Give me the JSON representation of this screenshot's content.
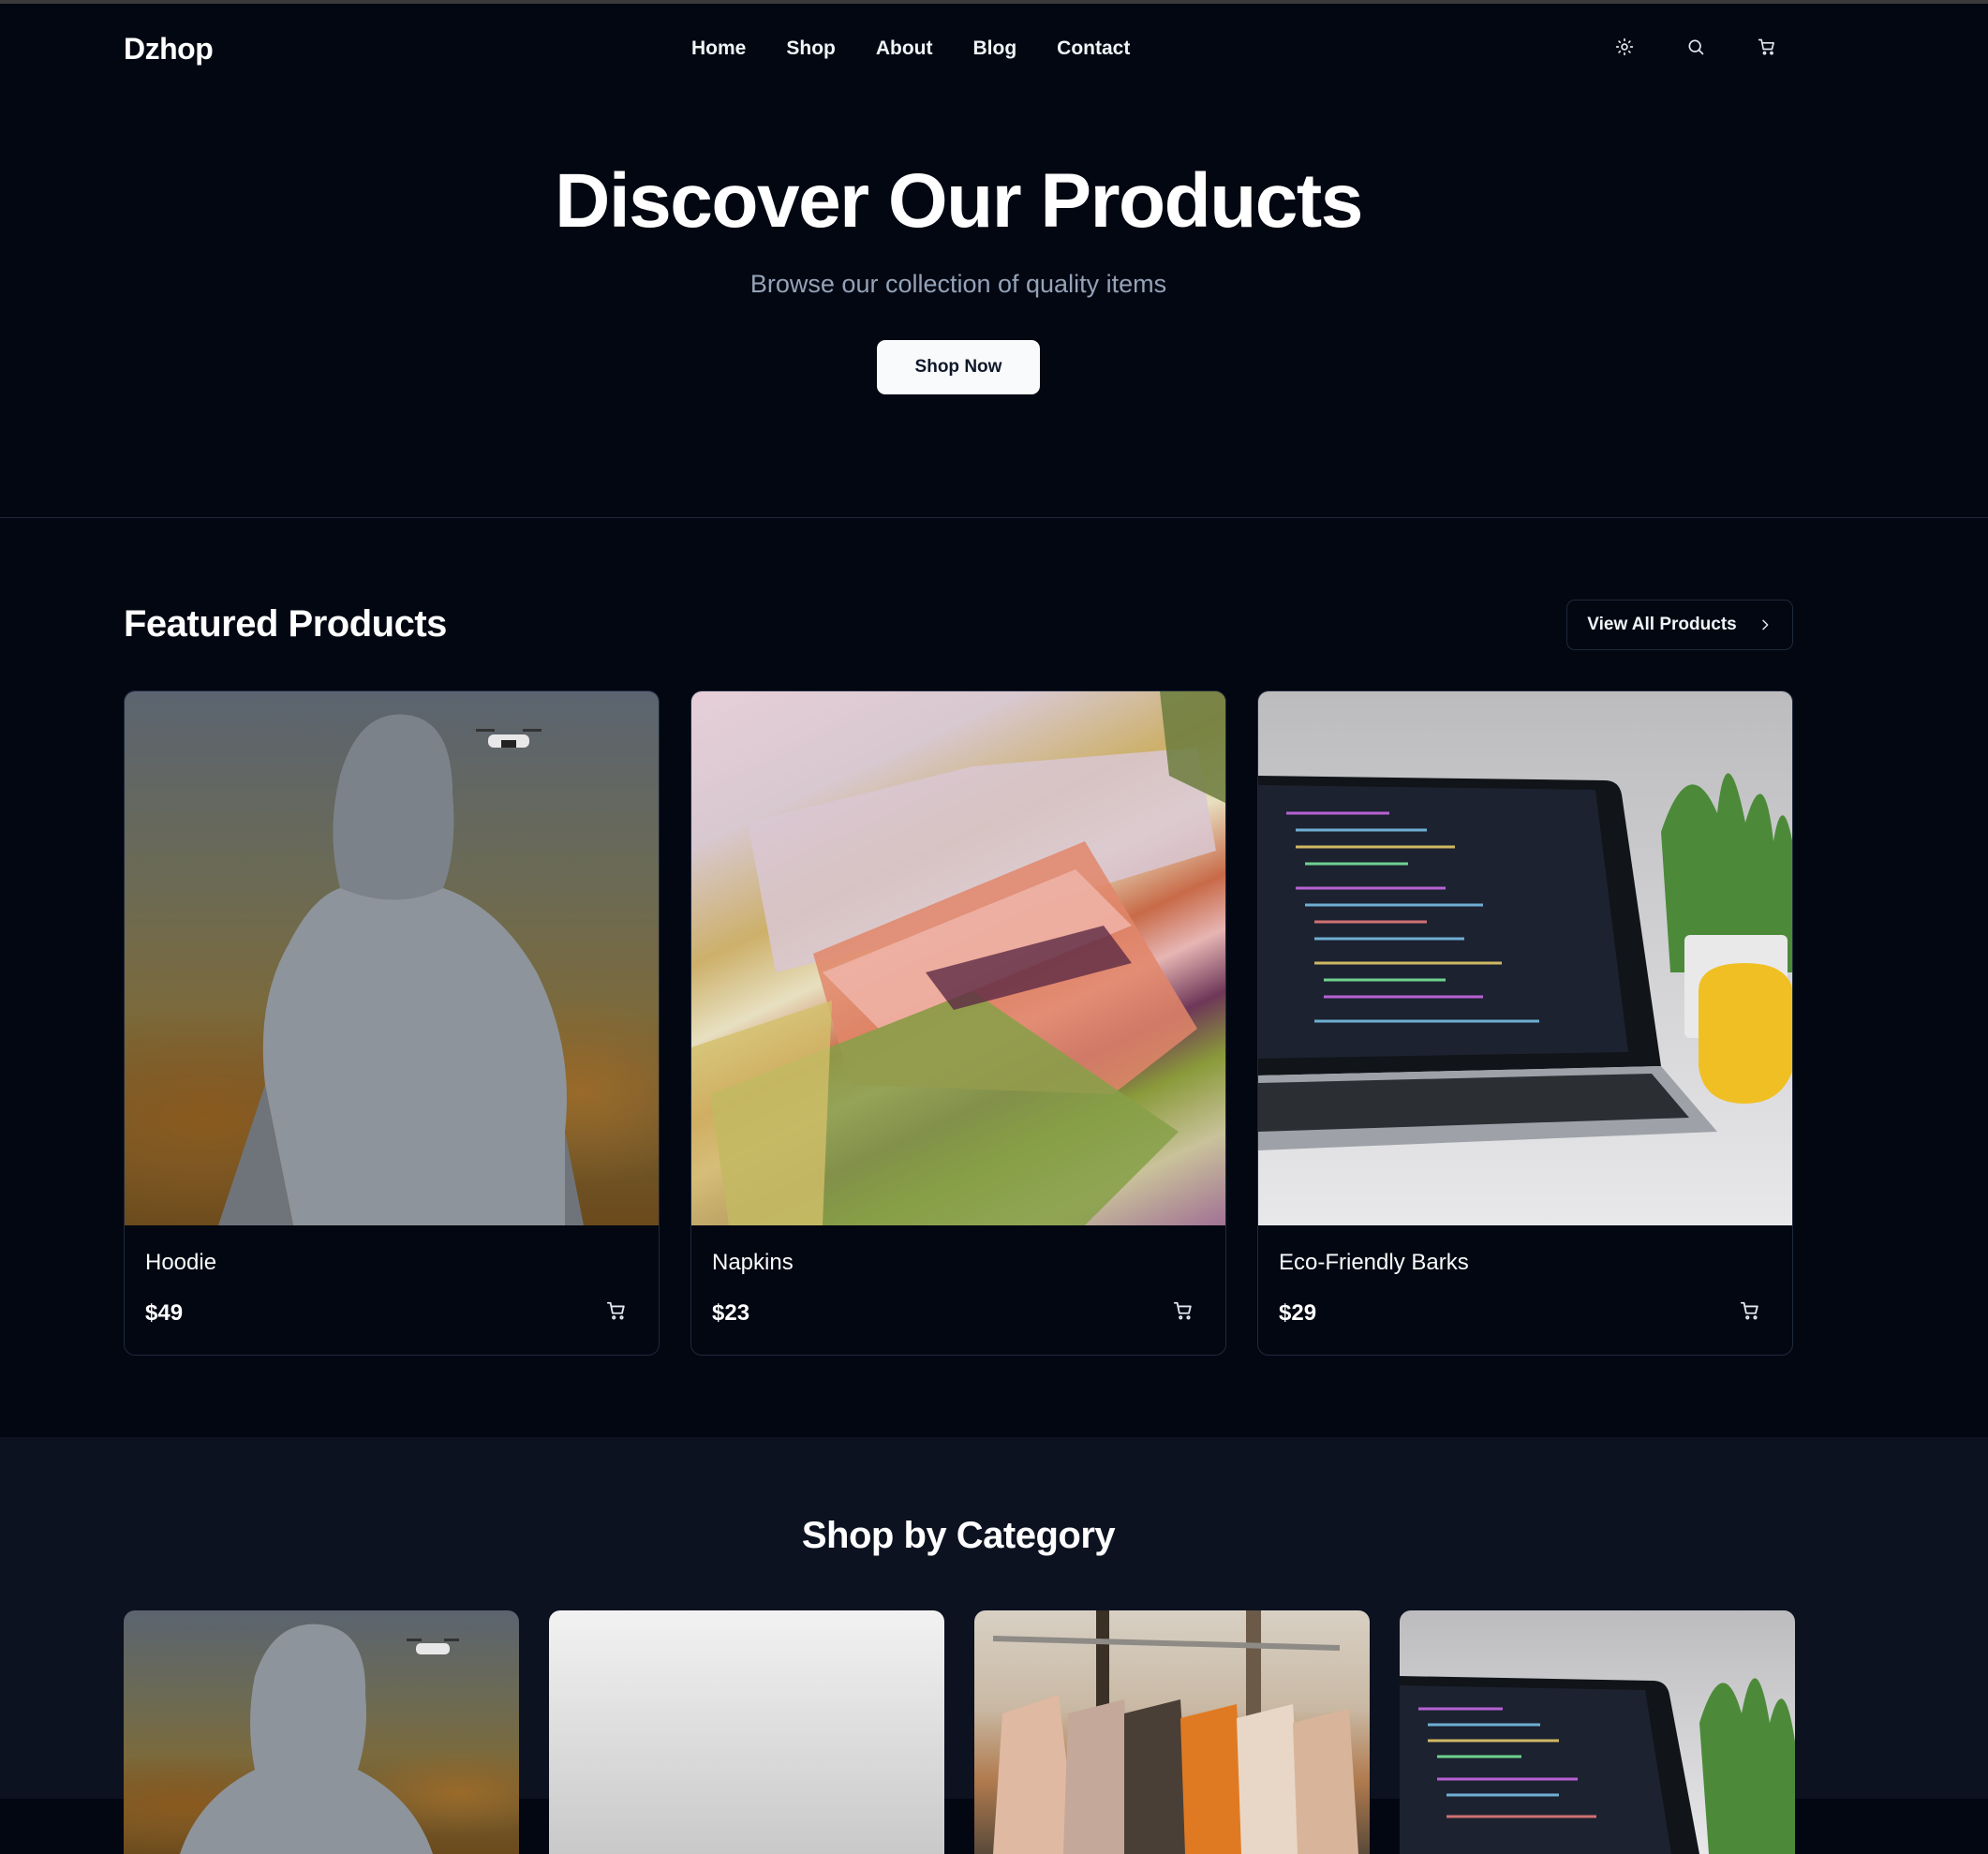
{
  "header": {
    "logo": "Dzhop",
    "nav": [
      "Home",
      "Shop",
      "About",
      "Blog",
      "Contact"
    ],
    "icons": [
      "sun-icon",
      "search-icon",
      "cart-icon"
    ]
  },
  "hero": {
    "title": "Discover Our Products",
    "subtitle": "Browse our collection of quality items",
    "cta": "Shop Now"
  },
  "featured": {
    "title": "Featured Products",
    "view_all": "View All Products",
    "products": [
      {
        "name": "Hoodie",
        "price": "$49"
      },
      {
        "name": "Napkins",
        "price": "$23"
      },
      {
        "name": "Eco-Friendly Barks",
        "price": "$29"
      }
    ]
  },
  "categories": {
    "title": "Shop by Category"
  },
  "colors": {
    "background": "#030712",
    "category_background": "#0c1220",
    "border": "#1e293b",
    "muted_text": "#94a3b8"
  }
}
